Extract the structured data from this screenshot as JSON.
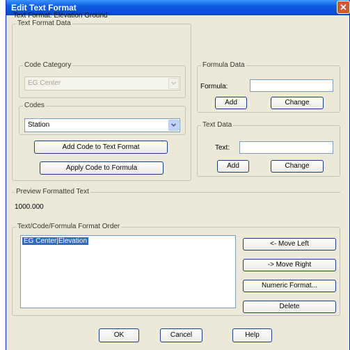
{
  "window": {
    "title": "Edit Text Format"
  },
  "header": {
    "text_format_line": "Text Format: Elevation Ground"
  },
  "text_format_data": {
    "legend": "Text Format Data",
    "code_category": {
      "legend": "Code Category",
      "value": "EG Center"
    },
    "codes": {
      "legend": "Codes",
      "value": "Station"
    },
    "add_code_button": "Add Code to Text Format",
    "apply_code_button": "Apply Code to Formula",
    "formula_data": {
      "legend": "Formula Data",
      "label": "Formula:",
      "value": "",
      "add_label": "Add",
      "change_label": "Change"
    },
    "text_data": {
      "legend": "Text Data",
      "label": "Text:",
      "value": "",
      "add_label": "Add",
      "change_label": "Change"
    }
  },
  "preview": {
    "legend": "Preview Formatted Text",
    "value": "1000.000"
  },
  "order": {
    "legend": "Text/Code/Formula Format Order",
    "items": [
      "EG Center|Elevation"
    ],
    "move_left": "<- Move Left",
    "move_right": "-> Move Right",
    "numeric_format": "Numeric Format...",
    "delete": "Delete"
  },
  "footer": {
    "ok": "OK",
    "cancel": "Cancel",
    "help": "Help"
  },
  "colors": {
    "titlebar": "#0a54d4",
    "dialog_bg": "#ece9d8",
    "selection": "#316ac5",
    "close": "#d8552f"
  }
}
